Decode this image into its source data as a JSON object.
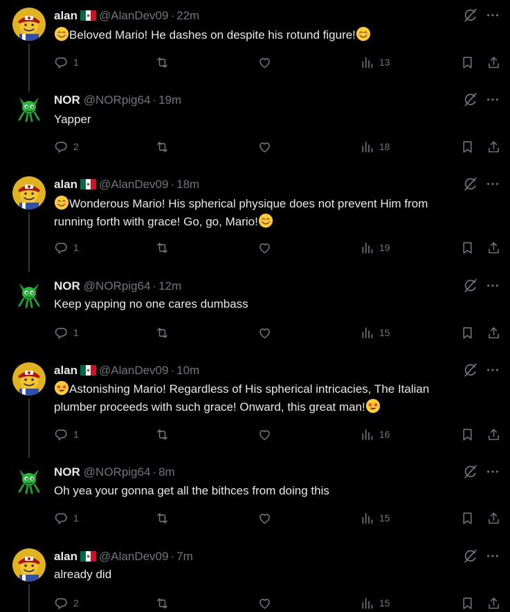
{
  "posts": [
    {
      "name": "alan",
      "handle": "@AlanDev09",
      "separator": "·",
      "time": "22m",
      "text_parts": [
        "Beloved Mario! He dashes on despite his rotund figure!"
      ],
      "emojis": [
        "smiling-blush-emoji",
        "smiling-blush-emoji"
      ],
      "replies": "1",
      "reposts": "",
      "likes": "",
      "views": "13"
    },
    {
      "name": "NOR",
      "handle": "@NORpig64",
      "separator": "·",
      "time": "19m",
      "text": "Yapper",
      "replies": "2",
      "reposts": "",
      "likes": "",
      "views": "18"
    },
    {
      "name": "alan",
      "handle": "@AlanDev09",
      "separator": "·",
      "time": "18m",
      "line1": "Wonderous Mario! His spherical  physique does not prevent Him from",
      "line2": "running forth with grace! Go, go, Mario!",
      "emojis": [
        "smiling-blush-emoji",
        "smiling-blush-emoji"
      ],
      "replies": "1",
      "reposts": "",
      "likes": "",
      "views": "19"
    },
    {
      "name": "NOR",
      "handle": "@NORpig64",
      "separator": "·",
      "time": "12m",
      "text": "Keep yapping no one cares dumbass",
      "replies": "1",
      "reposts": "",
      "likes": "",
      "views": "15"
    },
    {
      "name": "alan",
      "handle": "@AlanDev09",
      "separator": "·",
      "time": "10m",
      "line1": "Astonishing Mario! Regardless of His spherical intricacies, The Italian",
      "line2": "plumber proceeds with such grace! Onward, this great man!",
      "emojis": [
        "star-struck-emoji",
        "star-struck-emoji"
      ],
      "replies": "1",
      "reposts": "",
      "likes": "",
      "views": "16"
    },
    {
      "name": "NOR",
      "handle": "@NORpig64",
      "separator": "·",
      "time": "8m",
      "text": "Oh yea your gonna get all the bithces from doing this",
      "replies": "1",
      "reposts": "",
      "likes": "",
      "views": "15"
    },
    {
      "name": "alan",
      "handle": "@AlanDev09",
      "separator": "·",
      "time": "7m",
      "text": "already did",
      "replies": "2",
      "reposts": "",
      "likes": "",
      "views": "15"
    }
  ],
  "icons": {
    "reply": "reply-icon",
    "repost": "repost-icon",
    "like": "heart-icon",
    "views": "views-icon",
    "bookmark": "bookmark-icon",
    "share": "share-icon",
    "grok": "grok-icon",
    "more": "more-icon",
    "flag": "mexico-flag-icon"
  },
  "colors": {
    "background": "#000000",
    "text": "#e7e9ea",
    "muted": "#71767b",
    "thread_line": "#333639"
  }
}
